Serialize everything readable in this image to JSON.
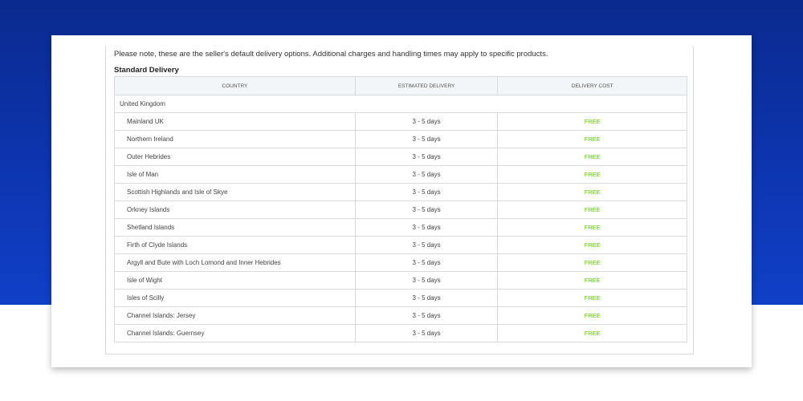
{
  "delivery": {
    "note": "Please note, these are the seller's default delivery options. Additional charges and handling times may apply to specific products.",
    "section_title": "Standard Delivery",
    "columns": [
      "COUNTRY",
      "ESTIMATED DELIVERY",
      "DELIVERY COST"
    ],
    "group": "United Kingdom",
    "cost_color": "#5fc200",
    "rows": [
      {
        "country": "Mainland UK",
        "estimate": "3 - 5 days",
        "cost": "FREE"
      },
      {
        "country": "Northern Ireland",
        "estimate": "3 - 5 days",
        "cost": "FREE"
      },
      {
        "country": "Outer Hebrides",
        "estimate": "3 - 5 days",
        "cost": "FREE"
      },
      {
        "country": "Isle of Man",
        "estimate": "3 - 5 days",
        "cost": "FREE"
      },
      {
        "country": "Scottish Highlands and Isle of Skye",
        "estimate": "3 - 5 days",
        "cost": "FREE"
      },
      {
        "country": "Orkney Islands",
        "estimate": "3 - 5 days",
        "cost": "FREE"
      },
      {
        "country": "Shetland Islands",
        "estimate": "3 - 5 days",
        "cost": "FREE"
      },
      {
        "country": "Firth of Clyde Islands",
        "estimate": "3 - 5 days",
        "cost": "FREE"
      },
      {
        "country": "Argyll and Bute with Loch Lomond and Inner Hebrides",
        "estimate": "3 - 5 days",
        "cost": "FREE"
      },
      {
        "country": "Isle of Wight",
        "estimate": "3 - 5 days",
        "cost": "FREE"
      },
      {
        "country": "Isles of Scilly",
        "estimate": "3 - 5 days",
        "cost": "FREE"
      },
      {
        "country": "Channel Islands: Jersey",
        "estimate": "3 - 5 days",
        "cost": "FREE"
      },
      {
        "country": "Channel Islands: Guernsey",
        "estimate": "3 - 5 days",
        "cost": "FREE"
      }
    ]
  }
}
